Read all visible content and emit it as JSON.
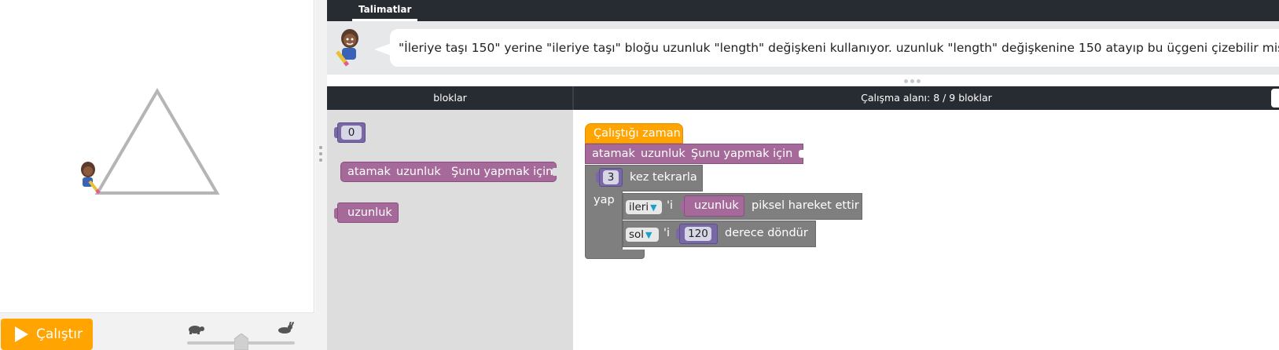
{
  "instructions": {
    "tab_label": "Talimatlar",
    "text": "\"İleriye taşı 150\" yerine \"ileriye taşı\" bloğu uzunluk \"length\" değişkeni kullanıyor. uzunluk \"length\" değişkenine 150 atayıp bu üçgeni çizebilir misin?"
  },
  "toolbox": {
    "header": "bloklar",
    "number_block_value": "0",
    "set_block": {
      "verb": "atamak",
      "var": "uzunluk",
      "action": "Şunu yapmak için"
    },
    "variable_block": "uzunluk"
  },
  "workspace": {
    "header": "Çalışma alanı: 8 / 9 bloklar",
    "when_run": "Çalıştığı zaman",
    "set_block": {
      "verb": "atamak",
      "var": "uzunluk",
      "action": "Şunu yapmak için"
    },
    "repeat": {
      "count": "3",
      "label": "kez tekrarla",
      "do_label": "yap"
    },
    "move": {
      "direction": "ileri",
      "suffix": "'i",
      "variable": "uzunluk",
      "label": "piksel hareket ettir"
    },
    "turn": {
      "direction": "sol",
      "suffix": "'i",
      "angle": "120",
      "label": "derece döndür"
    }
  },
  "controls": {
    "run_label": "Çalıştır",
    "speed_icons": [
      "turtle-icon",
      "rabbit-icon"
    ]
  },
  "colors": {
    "header_dark": "#272c33",
    "run_orange": "#ffa400",
    "variable_purple": "#a5699a",
    "number_purple": "#7a68a6",
    "loop_gray": "#7f7f7f",
    "dropdown_arrow": "#1ba1c8"
  }
}
